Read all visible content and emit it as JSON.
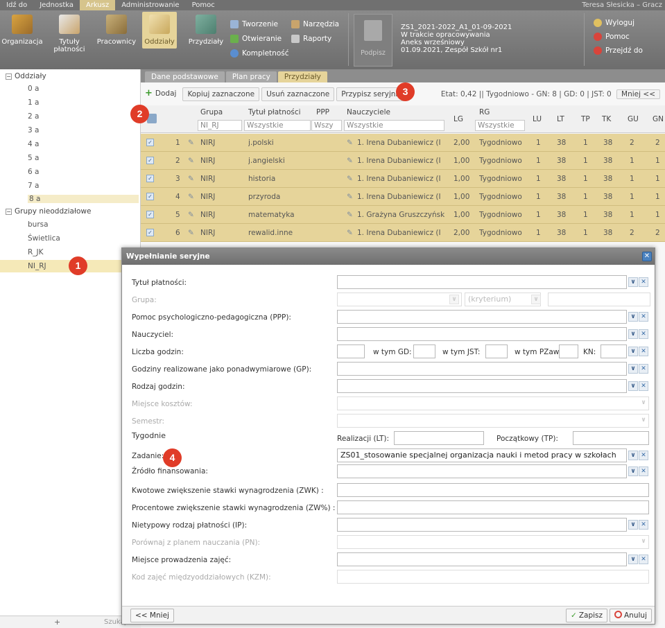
{
  "menu": {
    "items": [
      "Idź do",
      "Jednostka",
      "Arkusz",
      "Administrowanie",
      "Pomoc"
    ],
    "user": "Teresa Słesicka – Gracz"
  },
  "ribbon": {
    "buttons": [
      "Organizacja",
      "Tytuły\npłatności",
      "Pracownicy",
      "Oddziały",
      "Przydziały"
    ],
    "small": [
      "Tworzenie",
      "Otwieranie",
      "Kompletność",
      "Narzędzia",
      "Raporty"
    ],
    "doc": [
      "ZS1_2021-2022_A1_01-09-2021",
      "W trakcie opracowywania",
      "Aneks wrześniowy",
      "01.09.2021, Zespół Szkół nr1"
    ],
    "podpis": "Podpisz",
    "right": [
      "Wyloguj",
      "Pomoc",
      "Przejdź do"
    ]
  },
  "sidebar": {
    "oddzialy": "Oddziały",
    "classes": [
      "0 a",
      "1 a",
      "2 a",
      "3 a",
      "4 a",
      "5 a",
      "6 a",
      "7 a",
      "8 a"
    ],
    "grupy": "Grupy nieoddziałowe",
    "groups": [
      "bursa",
      "Świetlica",
      "R_JK",
      "NI_RJ"
    ],
    "search": "Szukaj"
  },
  "tabs": [
    "Dane podstawowe",
    "Plan pracy",
    "Przydziały"
  ],
  "toolbar": {
    "add": "Dodaj",
    "copy": "Kopiuj zaznaczone",
    "delete": "Usuń zaznaczone",
    "serial": "Przypisz seryjnie",
    "etat": "Etat: 0,42 || Tygodniowo - GN: 8 | GD: 0 | JST: 0",
    "less": "Mniej <<"
  },
  "grid": {
    "headers": [
      "Grupa",
      "Tytuł płatności",
      "PPP",
      "Nauczyciele",
      "LG",
      "RG",
      "LU",
      "LT",
      "TP",
      "TK",
      "GU",
      "GN"
    ],
    "filters": {
      "grupa": "NI_RJ",
      "tytul": "Wszystkie",
      "ppp": "Wszy",
      "naucz": "Wszystkie",
      "rg": "Wszystkie"
    },
    "rows": [
      {
        "n": "1",
        "grupa": "NIRJ",
        "tytul": "j.polski",
        "naucz": "1. Irena Dubaniewicz (I",
        "lg": "2,00",
        "rg": "Tygodniowo",
        "lu": "1",
        "lt": "38",
        "tp": "1",
        "tk": "38",
        "gu": "2",
        "gn": "2"
      },
      {
        "n": "2",
        "grupa": "NIRJ",
        "tytul": "j.angielski",
        "naucz": "1. Irena Dubaniewicz (I",
        "lg": "1,00",
        "rg": "Tygodniowo",
        "lu": "1",
        "lt": "38",
        "tp": "1",
        "tk": "38",
        "gu": "1",
        "gn": "1"
      },
      {
        "n": "3",
        "grupa": "NIRJ",
        "tytul": "historia",
        "naucz": "1. Irena Dubaniewicz (I",
        "lg": "1,00",
        "rg": "Tygodniowo",
        "lu": "1",
        "lt": "38",
        "tp": "1",
        "tk": "38",
        "gu": "1",
        "gn": "1"
      },
      {
        "n": "4",
        "grupa": "NIRJ",
        "tytul": "przyroda",
        "naucz": "1. Irena Dubaniewicz (I",
        "lg": "1,00",
        "rg": "Tygodniowo",
        "lu": "1",
        "lt": "38",
        "tp": "1",
        "tk": "38",
        "gu": "1",
        "gn": "1"
      },
      {
        "n": "5",
        "grupa": "NIRJ",
        "tytul": "matematyka",
        "naucz": "1. Grażyna Gruszczyńsk",
        "lg": "1,00",
        "rg": "Tygodniowo",
        "lu": "1",
        "lt": "38",
        "tp": "1",
        "tk": "38",
        "gu": "1",
        "gn": "1"
      },
      {
        "n": "6",
        "grupa": "NIRJ",
        "tytul": "rewalid.inne",
        "naucz": "1. Irena Dubaniewicz (I",
        "lg": "2,00",
        "rg": "Tygodniowo",
        "lu": "1",
        "lt": "38",
        "tp": "1",
        "tk": "38",
        "gu": "2",
        "gn": "2"
      }
    ]
  },
  "modal": {
    "title": "Wypełnianie seryjne",
    "labels": {
      "tytul": "Tytuł płatności:",
      "grupa": "Grupa:",
      "ppp": "Pomoc psychologiczno-pedagogiczna (PPP):",
      "naucz": "Nauczyciel:",
      "liczba": "Liczba godzin:",
      "gp": "Godziny realizowane jako ponadwymiarowe (GP):",
      "rodzaj": "Rodzaj godzin:",
      "miejsce_k": "Miejsce kosztów:",
      "semestr": "Semestr:",
      "tygodnie": "Tygodnie",
      "zadanie": "Zadanie:",
      "zrodlo": "Źródło finansowania:",
      "zwk": "Kwotowe zwiększenie stawki wynagrodzenia (ZWK) :",
      "zwp": "Procentowe zwiększenie stawki wynagrodzenia (ZW%) :",
      "ip": "Nietypowy rodzaj płatności (IP):",
      "pn": "Porównaj z planem nauczania (PN):",
      "miejsce_p": "Miejsce prowadzenia zajęć:",
      "kzm": "Kod zajęć międzyoddziałowych (KZM):"
    },
    "inline": {
      "gd": "w tym GD:",
      "jst": "w tym JST:",
      "pzaw": "w tym PZaw:",
      "kn": "KN:",
      "lt": "Realizacji (LT):",
      "tp": "Początkowy (TP):",
      "kryterium": "(kryterium)"
    },
    "zadanie_value": "ZS01_stosowanie specjalnej organizacja nauki i metod pracy w szkołach",
    "less": "<< Mniej",
    "save": "Zapisz",
    "cancel": "Anuluj"
  },
  "badges": [
    "1",
    "2",
    "3",
    "4"
  ]
}
